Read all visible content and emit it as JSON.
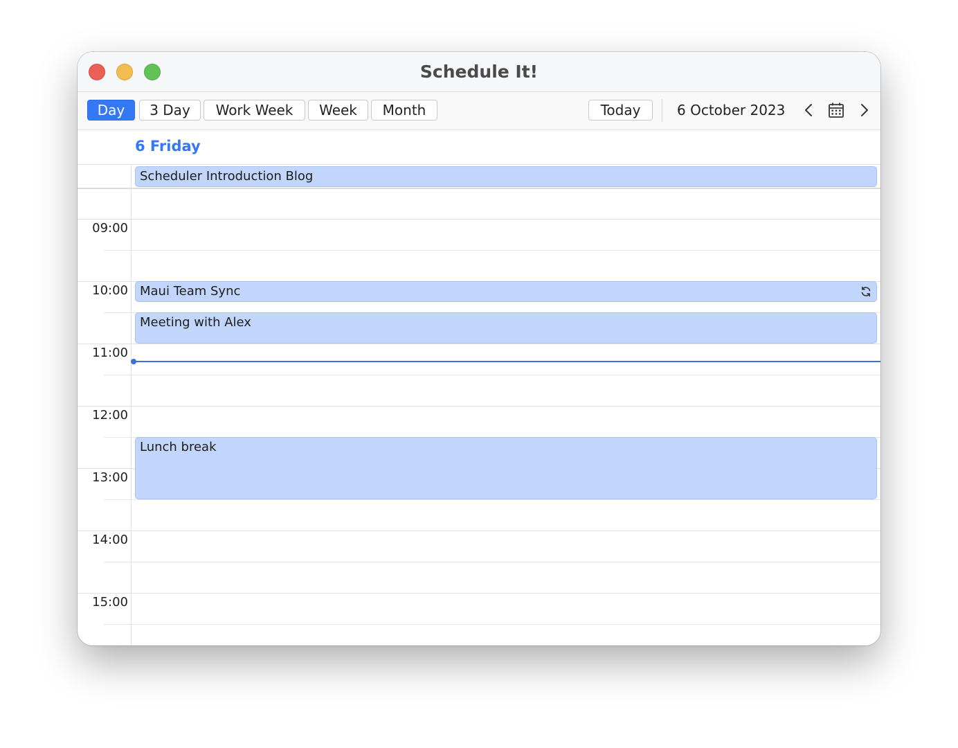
{
  "window": {
    "title": "Schedule It!"
  },
  "toolbar": {
    "views": [
      {
        "label": "Day",
        "active": true
      },
      {
        "label": "3 Day",
        "active": false
      },
      {
        "label": "Work Week",
        "active": false
      },
      {
        "label": "Week",
        "active": false
      },
      {
        "label": "Month",
        "active": false
      }
    ],
    "today_label": "Today",
    "current_date": "6 October 2023",
    "icons": [
      "chevron-left-icon",
      "calendar-icon",
      "chevron-right-icon"
    ]
  },
  "day_header": {
    "title": "6 Friday",
    "color": "#3478f6"
  },
  "all_day_events": [
    {
      "title": "Scheduler Introduction Blog"
    }
  ],
  "time_slots": [
    "09:00",
    "10:00",
    "11:00",
    "12:00",
    "13:00",
    "14:00",
    "15:00"
  ],
  "events": [
    {
      "title": "Maui Team Sync",
      "start": "10:00",
      "end": "10:30",
      "recurring": true
    },
    {
      "title": "Meeting with Alex",
      "start": "10:30",
      "end": "11:00",
      "recurring": false
    },
    {
      "title": "Lunch break",
      "start": "12:30",
      "end": "13:30",
      "recurring": false
    }
  ],
  "current_time_indicator": {
    "time": "11:10",
    "color": "#3a73d8"
  },
  "colors": {
    "accent": "#3478f6",
    "event_fill": "#c2d5fa",
    "close": "#ec5f57",
    "minimize": "#f4bd4f",
    "maximize": "#5fc454"
  }
}
